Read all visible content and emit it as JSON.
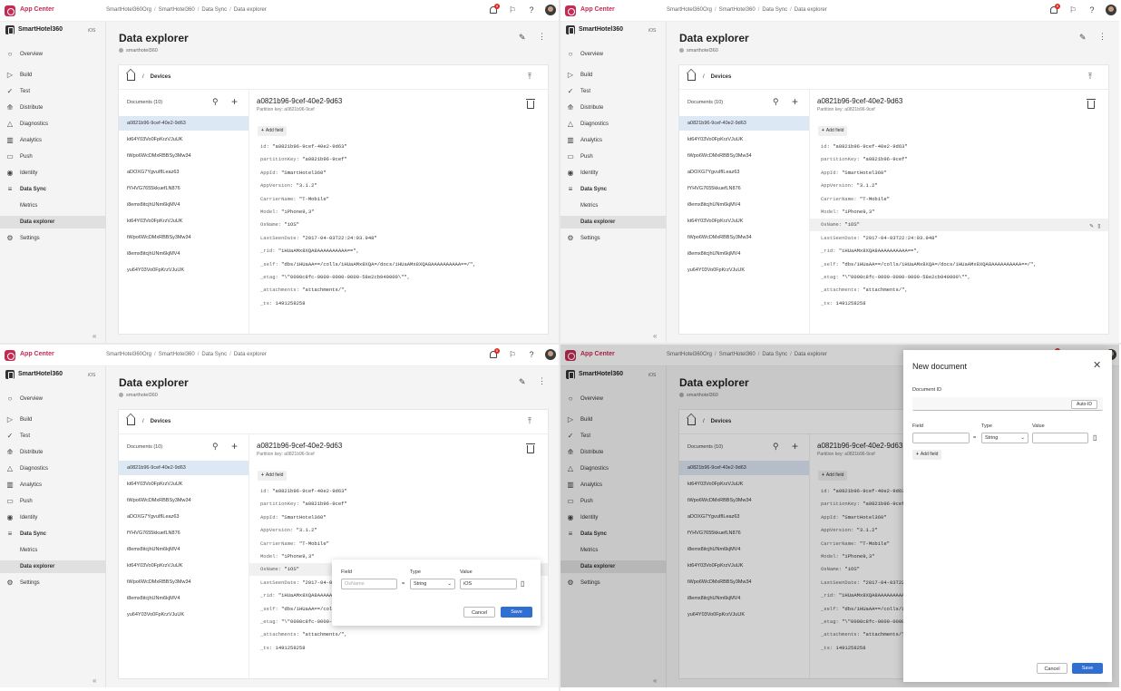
{
  "app": {
    "title": "App Center",
    "name": "SmartHotel360",
    "platform": "iOS",
    "notifications": "6"
  },
  "breadcrumb": [
    "SmartHotel360Org",
    "SmartHotel360",
    "Data Sync",
    "Data explorer"
  ],
  "nav": [
    "Overview",
    "Build",
    "Test",
    "Distribute",
    "Diagnostics",
    "Analytics",
    "Push",
    "Identity",
    "Data Sync",
    "Metrics",
    "Data explorer",
    "Settings"
  ],
  "page": {
    "title": "Data explorer",
    "subtitle": "smarthotel360",
    "collection_crumb": "Devices"
  },
  "docs": {
    "header": "Documents (10)",
    "items": [
      "a0821b96-9cef-40e2-9d63",
      "kt64Y03Vo0FpKrzVJuUK",
      "tWpo6WcDMxRBBSy3Mw34",
      "aDOXG7YgvuIfILeaz63",
      "fYHVG7655kkuefLN876",
      "i8emx8itcjhUNm6kjMV4",
      "kt64Y03Vo0FpKrzVJuUK",
      "tWpo6WcDMxRBBSy3Mw34",
      "i8emx8itcjhUNm6kjMV4",
      "yu64Y03Vo0FpKrzVJuUK"
    ]
  },
  "detail": {
    "title": "a0821b96-9cef-40e2-9d63",
    "partition": "Partition key: a0821b96-9cef",
    "add_field": "Add field",
    "fields": [
      {
        "k": "id:",
        "v": "\"a0821b96-9cef-40e2-9d63\""
      },
      {
        "k": "partitionKey:",
        "v": "\"a0821b96-9cef\""
      },
      {
        "k": "AppId:",
        "v": "\"SmartHotel360\""
      },
      {
        "k": "AppVersion:",
        "v": "\"3.1.2\""
      },
      {
        "k": "CarrierName:",
        "v": "\"T-Mobile\""
      },
      {
        "k": "Model:",
        "v": "\"iPhone9,3\""
      },
      {
        "k": "OsName:",
        "v": "\"iOS\""
      },
      {
        "k": "LastSeenDate:",
        "v": "\"2017-04-03T22:24:03.948\""
      },
      {
        "k": "_rid:",
        "v": "\"iHUaAMx8XQA8AAAAAAAAAA==\","
      },
      {
        "k": "_self:",
        "v": "\"dbs/iHUaAA==/colls/iHUaAMx8XQA=/docs/iHUaAMx8XQA8AAAAAAAAAA==/\","
      },
      {
        "k": "_etag:",
        "v": "\"\\\"0000c8fc-0000-0000-0000-58e2cb940000\\\"\","
      },
      {
        "k": "_attachments:",
        "v": "\"attachments/\","
      },
      {
        "k": "_ts:",
        "v": "1491258258"
      }
    ]
  },
  "edit_popup": {
    "field_label": "Field",
    "type_label": "Type",
    "value_label": "Value",
    "field_placeholder": "OsName",
    "type": "String",
    "value": "iOS",
    "cancel": "Cancel",
    "save": "Save"
  },
  "new_doc": {
    "title": "New document",
    "docid_label": "Document ID",
    "auto_id": "Auto-ID",
    "field_label": "Field",
    "type_label": "Type",
    "value_label": "Value",
    "type": "String",
    "add_field": "Add field",
    "cancel": "Cancel",
    "save": "Save"
  },
  "colors": {
    "brand": "#c52b52",
    "primary": "#2f6fd1",
    "selected": "#dde8f5"
  }
}
